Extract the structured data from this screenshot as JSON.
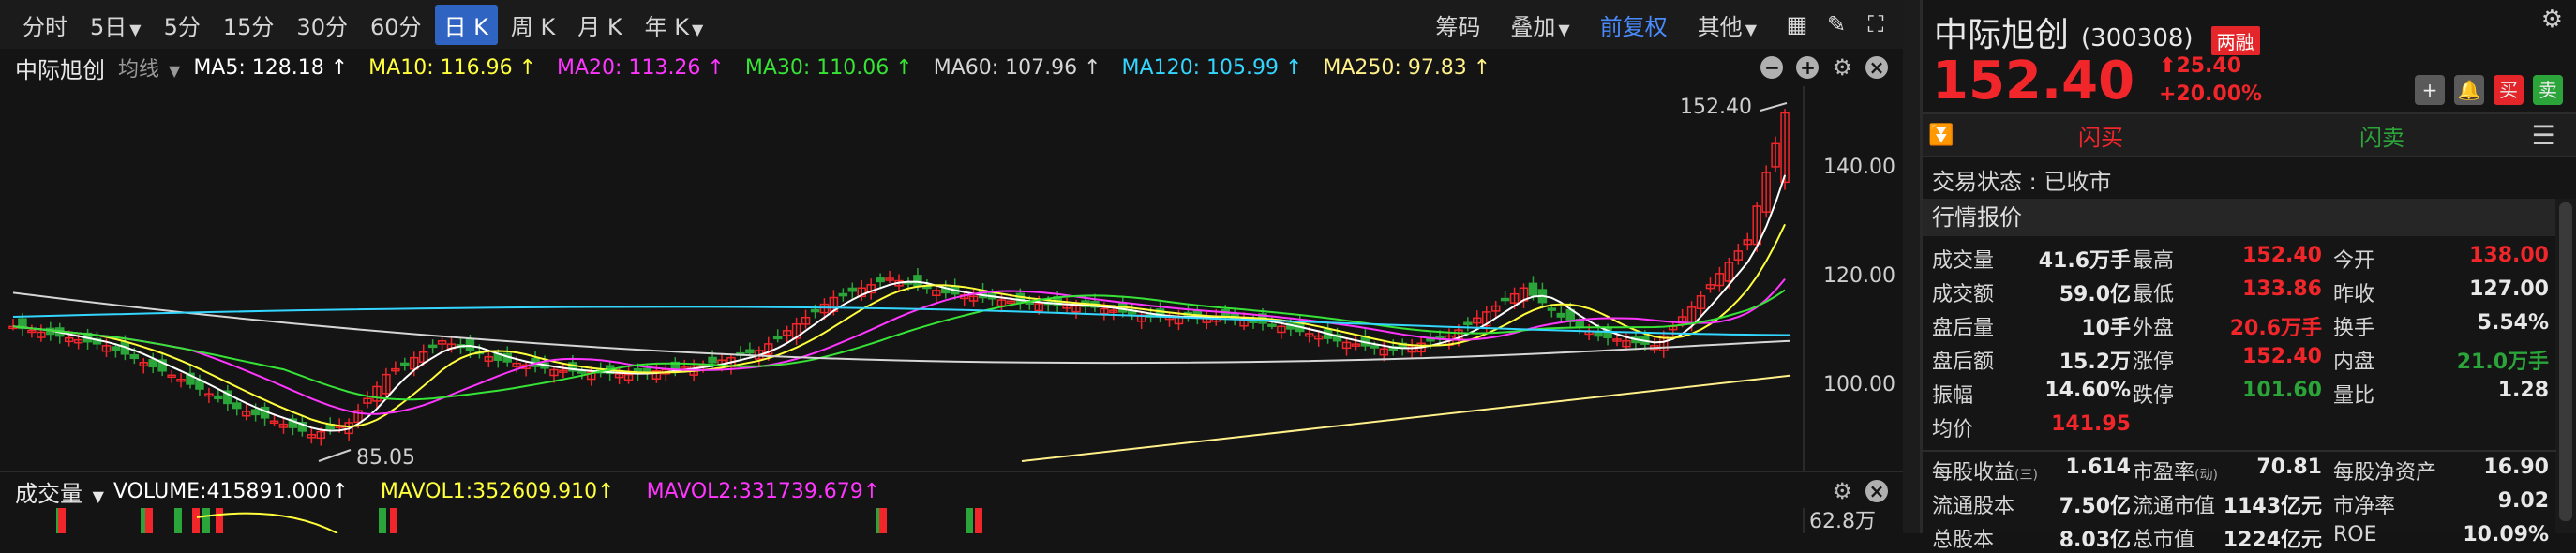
{
  "toolbar": {
    "periods": [
      {
        "label": "分时",
        "caret": false,
        "active": false
      },
      {
        "label": "5日",
        "caret": true,
        "active": false
      },
      {
        "label": "5分",
        "caret": false,
        "active": false
      },
      {
        "label": "15分",
        "caret": false,
        "active": false
      },
      {
        "label": "30分",
        "caret": false,
        "active": false
      },
      {
        "label": "60分",
        "caret": false,
        "active": false
      },
      {
        "label": "日 K",
        "caret": false,
        "active": true
      },
      {
        "label": "周 K",
        "caret": false,
        "active": false
      },
      {
        "label": "月 K",
        "caret": false,
        "active": false
      },
      {
        "label": "年 K",
        "caret": true,
        "active": false
      }
    ],
    "chip": "筹码",
    "overlay": "叠加",
    "adjust": "前复权",
    "other": "其他"
  },
  "ma_bar": {
    "stock_name": "中际旭创",
    "kind": "均线",
    "items": [
      {
        "text": "MA5: 128.18 ↑",
        "color": "#ffffff"
      },
      {
        "text": "MA10: 116.96 ↑",
        "color": "#ffff3c"
      },
      {
        "text": "MA20: 113.26 ↑",
        "color": "#ff36ff"
      },
      {
        "text": "MA30: 110.06 ↑",
        "color": "#36e336"
      },
      {
        "text": "MA60: 107.96 ↑",
        "color": "#d6d6d6"
      },
      {
        "text": "MA120: 105.99 ↑",
        "color": "#33d6ff"
      },
      {
        "text": "MA250: 97.83 ↑",
        "color": "#fff08a"
      }
    ]
  },
  "chart": {
    "price_axis": [
      "140.00",
      "120.00",
      "100.00"
    ],
    "high_label": "152.40",
    "low_label": "85.05",
    "colors": {
      "up": "#f0262a",
      "down": "#2ba53a",
      "ma5": "#ffffff",
      "ma10": "#ffff3c",
      "ma20": "#ff36ff",
      "ma30": "#36e336",
      "ma60": "#d6d6d6",
      "ma120": "#33d6ff",
      "ma250": "#fff08a"
    }
  },
  "volume_bar": {
    "title": "成交量",
    "volume": "VOLUME:415891.000↑",
    "mavol1": "MAVOL1:352609.910↑",
    "mavol2": "MAVOL2:331739.679↑",
    "top_label": "62.8万"
  },
  "quote": {
    "name": "中际旭创",
    "code": "(300308)",
    "badge": "两融",
    "price": "152.40",
    "change": "25.40",
    "change_pct": "+20.00%",
    "trade_buy": "闪买",
    "trade_sell": "闪卖",
    "buy_btn": "买",
    "sell_btn": "卖",
    "status": "交易状态 : 已收市",
    "section": "行情报价",
    "rows": [
      [
        {
          "l": "成交量",
          "v": "41.6万手",
          "c": "white"
        },
        {
          "l": "最高",
          "v": "152.40",
          "c": "red"
        },
        {
          "l": "今开",
          "v": "138.00",
          "c": "red"
        }
      ],
      [
        {
          "l": "成交额",
          "v": "59.0亿",
          "c": "white"
        },
        {
          "l": "最低",
          "v": "133.86",
          "c": "red"
        },
        {
          "l": "昨收",
          "v": "127.00",
          "c": "white"
        }
      ],
      [
        {
          "l": "盘后量",
          "v": "10手",
          "c": "white"
        },
        {
          "l": "外盘",
          "v": "20.6万手",
          "c": "red"
        },
        {
          "l": "换手",
          "v": "5.54%",
          "c": "white"
        }
      ],
      [
        {
          "l": "盘后额",
          "v": "15.2万",
          "c": "white"
        },
        {
          "l": "涨停",
          "v": "152.40",
          "c": "red"
        },
        {
          "l": "内盘",
          "v": "21.0万手",
          "c": "green"
        }
      ],
      [
        {
          "l": "振幅",
          "v": "14.60%",
          "c": "white"
        },
        {
          "l": "跌停",
          "v": "101.60",
          "c": "green"
        },
        {
          "l": "量比",
          "v": "1.28",
          "c": "white"
        }
      ],
      [
        {
          "l": "均价",
          "v": "141.95",
          "c": "red"
        }
      ]
    ],
    "rows2": [
      [
        {
          "l": "每股收益",
          "s": "(三)",
          "v": "1.614"
        },
        {
          "l": "市盈率",
          "s": "(动)",
          "v": "70.81"
        },
        {
          "l": "每股净资产",
          "s": "",
          "v": "16.90"
        }
      ],
      [
        {
          "l": "流通股本",
          "s": "",
          "v": "7.50亿"
        },
        {
          "l": "流通市值",
          "s": "",
          "v": "1143亿元"
        },
        {
          "l": "市净率",
          "s": "",
          "v": "9.02"
        }
      ],
      [
        {
          "l": "总股本",
          "s": "",
          "v": "8.03亿"
        },
        {
          "l": "总市值",
          "s": "",
          "v": "1224亿元"
        },
        {
          "l": "ROE",
          "s": "",
          "v": "10.09%"
        }
      ]
    ]
  }
}
